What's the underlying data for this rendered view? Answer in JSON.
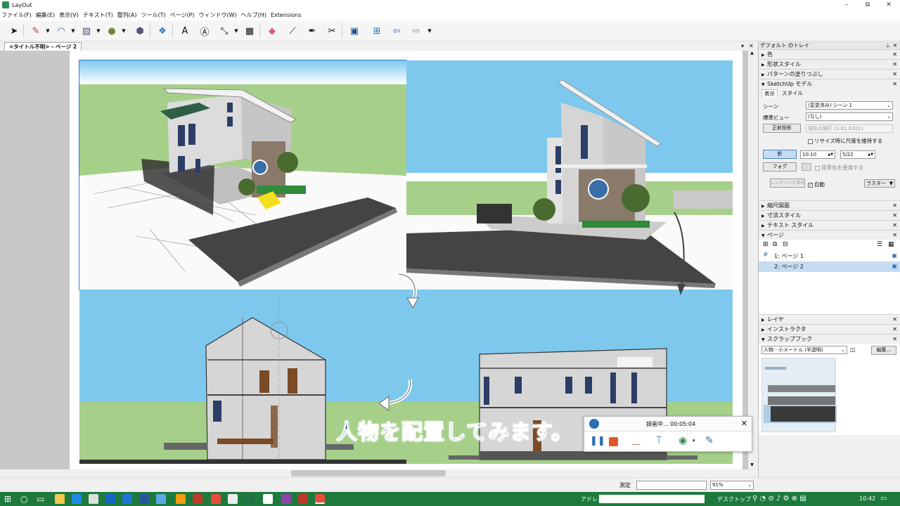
{
  "window": {
    "title": "LayOut",
    "minimize": "–",
    "maximize": "⧉",
    "close": "✕"
  },
  "menu": [
    "ファイル(F)",
    "編集(E)",
    "表示(V)",
    "テキスト(T)",
    "整列(A)",
    "ツール(T)",
    "ページ(P)",
    "ウィンドウ(W)",
    "ヘルプ(H)",
    "Extensions"
  ],
  "doc_tab": {
    "label": "<タイトル不明> - ページ 2",
    "close": "✕"
  },
  "panel": {
    "title": "デフォルト のトレイ",
    "sections_top": [
      "色",
      "形状スタイル",
      "パターンの塗りつぶし"
    ],
    "sketchup": {
      "title": "SketchUp モデル",
      "tabs": [
        "表示",
        "スタイル"
      ],
      "scene_label": "シーン",
      "scene_value": "(変更済み) シーン 1",
      "view_label": "標準ビュー",
      "view_value": "(なし)",
      "ortho_button": "正射投影",
      "scale_value": "現在の縮尺 (1:81.6321)",
      "keep_scale": "リサイズ時に尺度を維持する",
      "shadow_button": "影",
      "time_value": "10:10",
      "date_value": "5/22",
      "fog_button": "フォグ",
      "bg_color": "背景色を使用する",
      "render_button": "レンダリング済み",
      "auto": "自動",
      "raster": "ラスター"
    },
    "sections_mid": [
      "縮尺図面",
      "寸法スタイル",
      "テキスト スタイル"
    ],
    "pages": {
      "title": "ページ",
      "items": [
        {
          "label": "1: ページ 1"
        },
        {
          "label": "2: ページ 2"
        }
      ]
    },
    "sections_bottom": [
      "レイヤ",
      "インストラクタ",
      "スクラップブック"
    ],
    "scrapbook": {
      "select_value": "人物 - 小メートル (半透明)",
      "edit_button": "編集..."
    }
  },
  "status": {
    "measure_label": "測定",
    "zoom": "91%"
  },
  "recorder": {
    "text": "録画中... 00:05:04"
  },
  "subtitle": "人物を配置してみます。",
  "taskbar": {
    "address_label": "アドレス",
    "desktop_label": "デスクトップ",
    "time": "10:42"
  },
  "colors": {
    "accent": "#2e8b57",
    "sky": "#7ec8ee",
    "grass": "#a6d08a",
    "selection": "#c5dcf3"
  }
}
